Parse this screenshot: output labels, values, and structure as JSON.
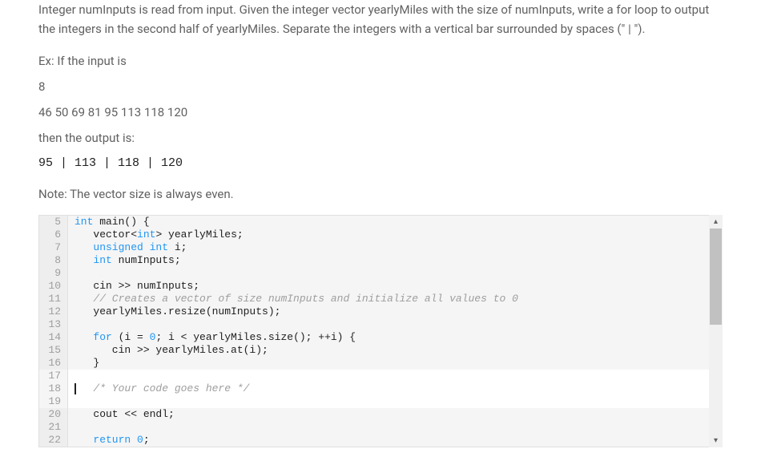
{
  "problem": {
    "description": "Integer numInputs is read from input. Given the integer vector yearlyMiles with the size of numInputs, write a for loop to output the integers in the second half of yearlyMiles. Separate the integers with a vertical bar surrounded by spaces (\" | \").",
    "example_label": "Ex: If the input is",
    "example_input_1": "8",
    "example_input_2": "46 50 69 81 95 113 118 120",
    "output_label": "then the output is:",
    "output_value": "95 | 113 | 118 | 120",
    "note": "Note: The vector size is always even."
  },
  "code": {
    "lines": [
      {
        "num": "5",
        "readonly": true,
        "tokens": [
          {
            "t": "int",
            "c": "kw-type"
          },
          {
            "t": " main() {",
            "c": "kw-punct"
          }
        ]
      },
      {
        "num": "6",
        "readonly": true,
        "tokens": [
          {
            "t": "   vector",
            "c": "kw-ident"
          },
          {
            "t": "<",
            "c": "kw-punct"
          },
          {
            "t": "int",
            "c": "kw-type"
          },
          {
            "t": ">",
            "c": "kw-punct"
          },
          {
            "t": " yearlyMiles;",
            "c": "kw-ident"
          }
        ]
      },
      {
        "num": "7",
        "readonly": true,
        "tokens": [
          {
            "t": "   ",
            "c": ""
          },
          {
            "t": "unsigned int",
            "c": "kw-type"
          },
          {
            "t": " i;",
            "c": "kw-ident"
          }
        ]
      },
      {
        "num": "8",
        "readonly": true,
        "tokens": [
          {
            "t": "   ",
            "c": ""
          },
          {
            "t": "int",
            "c": "kw-type"
          },
          {
            "t": " numInputs;",
            "c": "kw-ident"
          }
        ]
      },
      {
        "num": "9",
        "readonly": true,
        "tokens": []
      },
      {
        "num": "10",
        "readonly": true,
        "tokens": [
          {
            "t": "   cin >> numInputs;",
            "c": "kw-ident"
          }
        ]
      },
      {
        "num": "11",
        "readonly": true,
        "tokens": [
          {
            "t": "   ",
            "c": ""
          },
          {
            "t": "// Creates a vector of size numInputs and initialize all values to 0",
            "c": "kw-comment"
          }
        ]
      },
      {
        "num": "12",
        "readonly": true,
        "tokens": [
          {
            "t": "   yearlyMiles.resize(numInputs);",
            "c": "kw-ident"
          }
        ]
      },
      {
        "num": "13",
        "readonly": true,
        "tokens": []
      },
      {
        "num": "14",
        "readonly": true,
        "tokens": [
          {
            "t": "   ",
            "c": ""
          },
          {
            "t": "for",
            "c": "kw-keyword"
          },
          {
            "t": " (i = ",
            "c": "kw-ident"
          },
          {
            "t": "0",
            "c": "kw-num"
          },
          {
            "t": "; i < yearlyMiles.size(); ++i) {",
            "c": "kw-ident"
          }
        ]
      },
      {
        "num": "15",
        "readonly": true,
        "tokens": [
          {
            "t": "      cin >> yearlyMiles.at(i);",
            "c": "kw-ident"
          }
        ]
      },
      {
        "num": "16",
        "readonly": true,
        "tokens": [
          {
            "t": "   }",
            "c": "kw-ident"
          }
        ]
      },
      {
        "num": "17",
        "readonly": false,
        "tokens": []
      },
      {
        "num": "18",
        "readonly": false,
        "cursor": true,
        "tokens": [
          {
            "t": "   ",
            "c": ""
          },
          {
            "t": "/* Your code goes here */",
            "c": "kw-comment"
          }
        ]
      },
      {
        "num": "19",
        "readonly": false,
        "tokens": []
      },
      {
        "num": "20",
        "readonly": true,
        "tokens": [
          {
            "t": "   cout << endl;",
            "c": "kw-ident"
          }
        ]
      },
      {
        "num": "21",
        "readonly": true,
        "tokens": []
      },
      {
        "num": "22",
        "readonly": true,
        "tokens": [
          {
            "t": "   ",
            "c": ""
          },
          {
            "t": "return",
            "c": "kw-keyword"
          },
          {
            "t": " ",
            "c": ""
          },
          {
            "t": "0",
            "c": "kw-num"
          },
          {
            "t": ";",
            "c": "kw-ident"
          }
        ]
      }
    ]
  },
  "scrollbar": {
    "up_arrow": "▴",
    "down_arrow": "▾"
  }
}
